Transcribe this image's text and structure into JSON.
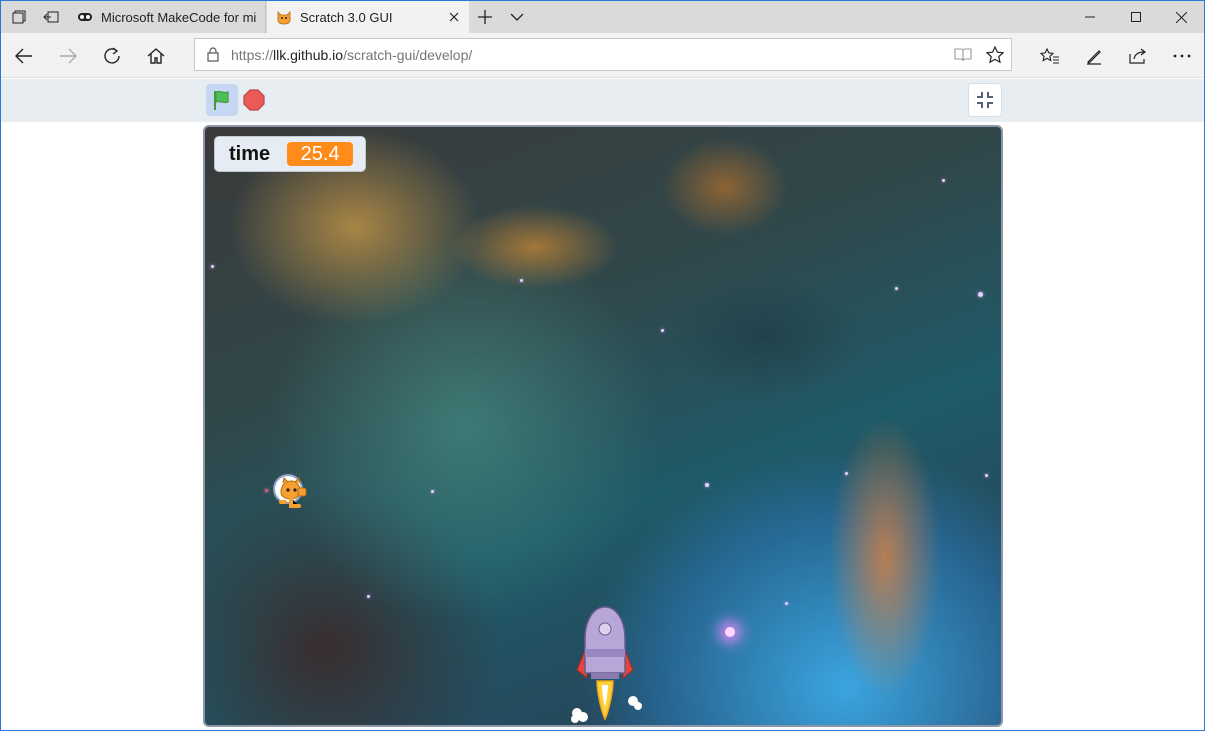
{
  "browser": {
    "tabs": [
      {
        "title": "Microsoft MakeCode for mi",
        "favicon": "makecode-icon",
        "active": false
      },
      {
        "title": "Scratch 3.0 GUI",
        "favicon": "scratch-cat-icon",
        "active": true
      }
    ],
    "address": {
      "prefix": "https://",
      "host": "llk.github.io",
      "path": "/scratch-gui/develop/"
    },
    "accent": "#2b78d4"
  },
  "scratch": {
    "flag_color": "#4cbf56",
    "stop_color": "#ec5959",
    "monitor": {
      "label": "time",
      "value": "25.4",
      "value_color": "#ff8c1a"
    },
    "sprites": [
      "cat-astronaut-sprite",
      "rocketship-sprite"
    ]
  }
}
